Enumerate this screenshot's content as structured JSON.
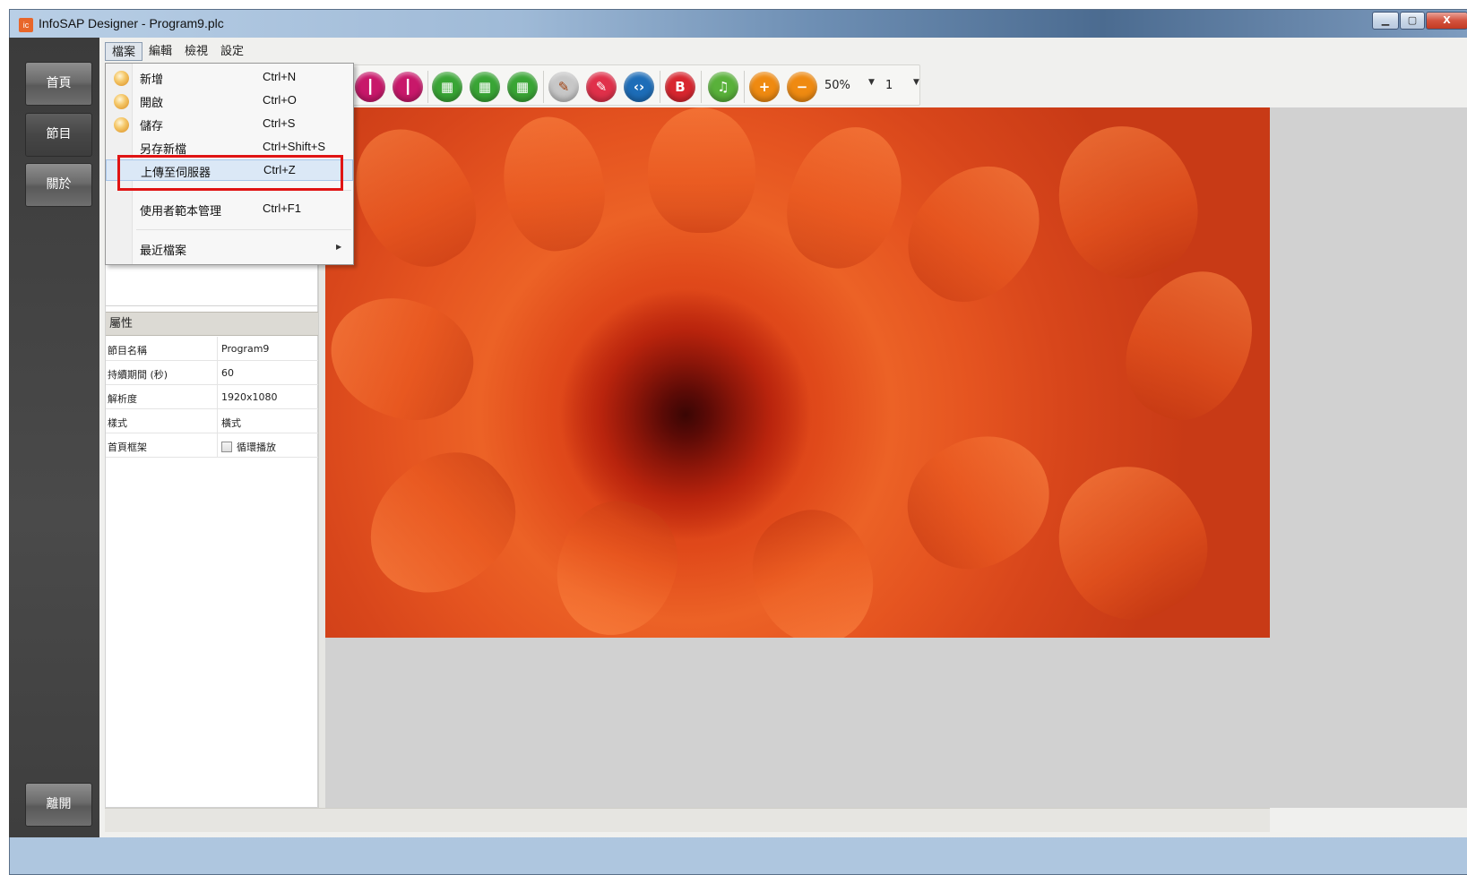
{
  "window": {
    "title": "InfoSAP Designer - Program9.plc",
    "app_icon": "ic"
  },
  "window_controls": {
    "minimize": "▁",
    "maximize": "▢",
    "close": "X"
  },
  "leftnav": {
    "items": [
      {
        "label": "首頁"
      },
      {
        "label": "節目"
      },
      {
        "label": "關於"
      }
    ],
    "exit": "離開"
  },
  "menubar": {
    "items": [
      {
        "label": "檔案"
      },
      {
        "label": "編輯"
      },
      {
        "label": "檢視"
      },
      {
        "label": "設定"
      }
    ]
  },
  "toolbar": {
    "tools": [
      {
        "icon": "text-marker-icon"
      },
      {
        "icon": "text-marker-2-icon"
      },
      {
        "icon": "video-icon"
      },
      {
        "icon": "video-2-icon"
      },
      {
        "icon": "video-add-icon"
      },
      {
        "icon": "paint-palette-icon"
      },
      {
        "icon": "paint-palette-2-icon"
      },
      {
        "icon": "code-icon"
      },
      {
        "icon": "calendar-icon"
      },
      {
        "icon": "music-icon"
      },
      {
        "icon": "zoom-in-icon"
      },
      {
        "icon": "zoom-out-icon"
      }
    ],
    "zoom": "50%",
    "page": "1",
    "glyphs": {
      "text1": "┃",
      "text2": "┃",
      "video1": "▦",
      "video2": "▦",
      "video3": "▦",
      "paint1": "✎",
      "paint2": "✎",
      "code": "‹›",
      "calendar": "B",
      "music": "♫",
      "plus": "+",
      "minus": "−"
    }
  },
  "file_menu": {
    "items": [
      {
        "label": "新增",
        "shortcut": "Ctrl+N",
        "icon": "new-icon"
      },
      {
        "label": "開啟",
        "shortcut": "Ctrl+O",
        "icon": "open-icon"
      },
      {
        "label": "儲存",
        "shortcut": "Ctrl+S",
        "icon": "save-icon"
      },
      {
        "label": "另存新檔",
        "shortcut": "Ctrl+Shift+S"
      },
      {
        "label": "上傳至伺服器",
        "shortcut": "Ctrl+Z",
        "highlighted": true
      },
      {
        "label": "使用者範本管理",
        "shortcut": "Ctrl+F1"
      },
      {
        "label": "最近檔案",
        "submenu": true
      }
    ]
  },
  "properties": {
    "header": "屬性",
    "rows": [
      {
        "key": "節目名稱",
        "value": "Program9"
      },
      {
        "key": "持續期間 (秒)",
        "value": "60"
      },
      {
        "key": "解析度",
        "value": "1920x1080"
      },
      {
        "key": "樣式",
        "value": "橫式"
      },
      {
        "key": "首頁框架",
        "value": "循環播放",
        "checkbox": false
      }
    ]
  },
  "colors": {
    "accent_highlight": "#e01414",
    "nav_bg": "#3b3b3b",
    "menu_hover": "#dbe8f6"
  }
}
